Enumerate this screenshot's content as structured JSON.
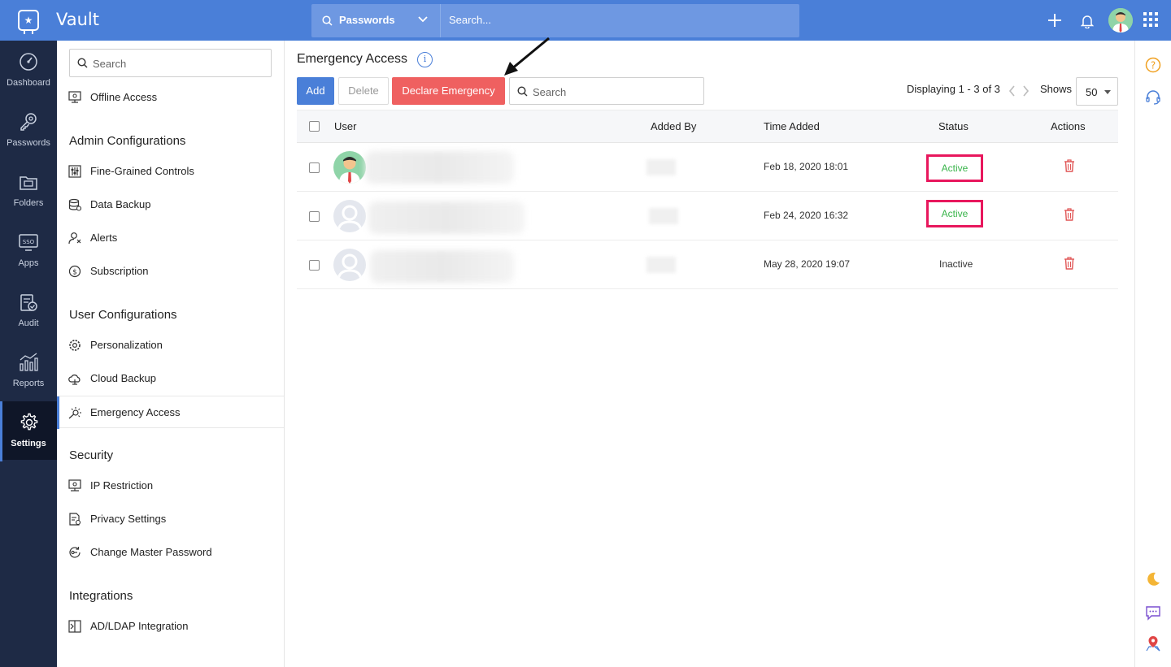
{
  "topbar": {
    "app_title": "Vault",
    "search_scope": "Passwords",
    "search_placeholder": "Search...",
    "icons": [
      "vault-logo-icon",
      "search-icon",
      "chevron-down-icon",
      "plus-icon",
      "bell-icon",
      "avatar",
      "app-grid-icon"
    ]
  },
  "leftnav": {
    "items": [
      {
        "label": "Dashboard",
        "icon": "dashboard-icon"
      },
      {
        "label": "Passwords",
        "icon": "key-icon"
      },
      {
        "label": "Folders",
        "icon": "folder-icon"
      },
      {
        "label": "Apps",
        "icon": "sso-icon"
      },
      {
        "label": "Audit",
        "icon": "audit-icon"
      },
      {
        "label": "Reports",
        "icon": "reports-icon"
      },
      {
        "label": "Settings",
        "icon": "gear-icon",
        "active": true
      }
    ]
  },
  "panel": {
    "search_placeholder": "Search",
    "top_item": "Offline Access",
    "sections": [
      {
        "title": "Admin Configurations",
        "items": [
          "Fine-Grained Controls",
          "Data Backup",
          "Alerts",
          "Subscription"
        ]
      },
      {
        "title": "User Configurations",
        "items": [
          "Personalization",
          "Cloud Backup",
          "Emergency Access"
        ]
      },
      {
        "title": "Security",
        "items": [
          "IP Restriction",
          "Privacy Settings",
          "Change Master Password"
        ]
      },
      {
        "title": "Integrations",
        "items": [
          "AD/LDAP Integration"
        ]
      }
    ],
    "active_item": "Emergency Access"
  },
  "main": {
    "title": "Emergency Access",
    "buttons": {
      "add": "Add",
      "delete": "Delete",
      "declare": "Declare Emergency"
    },
    "search_placeholder": "Search",
    "paging": "Displaying 1 - 3 of 3",
    "shows_label": "Shows",
    "per_page": "50",
    "columns": [
      "User",
      "Added By",
      "Time Added",
      "Status",
      "Actions"
    ],
    "rows": [
      {
        "time": "Feb 18, 2020 18:01",
        "status": "Active"
      },
      {
        "time": "Feb 24, 2020 16:32",
        "status": "Active"
      },
      {
        "time": "May 28, 2020 19:07",
        "status": "Inactive"
      }
    ]
  },
  "colors": {
    "brand": "#4a7fd8",
    "nav_bg": "#1e2a45",
    "declare_btn": "#ef6060",
    "active_status": "#38b44a",
    "highlight_box": "#e8175d",
    "trash": "#e05555"
  }
}
